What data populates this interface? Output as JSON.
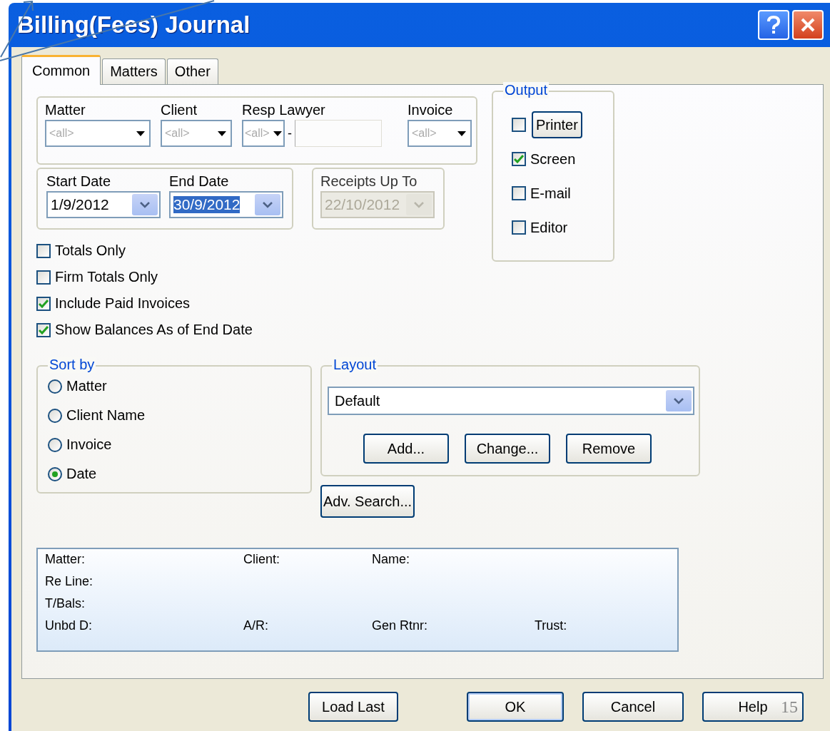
{
  "window": {
    "title": "Billing(Fees) Journal"
  },
  "tabs": [
    {
      "label": "Common",
      "selected": true
    },
    {
      "label": "Matters",
      "selected": false
    },
    {
      "label": "Other",
      "selected": false
    }
  ],
  "filters": [
    {
      "label": "Matter",
      "value": "<all>"
    },
    {
      "label": "Client",
      "value": "<all>"
    },
    {
      "label": "Resp Lawyer",
      "value": "<all>",
      "separator": "-"
    },
    {
      "label": "Invoice",
      "value": "<all>"
    }
  ],
  "dates": [
    {
      "label": "Start Date",
      "value": "1/9/2012",
      "selected": false,
      "disabled": false
    },
    {
      "label": "End Date",
      "value": "30/9/2012",
      "selected": true,
      "disabled": false
    },
    {
      "label": "Receipts Up To",
      "value": "22/10/2012",
      "selected": false,
      "disabled": true
    }
  ],
  "output": {
    "title": "Output",
    "items": [
      {
        "kind": "button",
        "label": "Printer",
        "checked": false
      },
      {
        "kind": "label",
        "label": "Screen",
        "checked": true
      },
      {
        "kind": "label",
        "label": "E-mail",
        "checked": false
      },
      {
        "kind": "label",
        "label": "Editor",
        "checked": false
      }
    ]
  },
  "options": [
    {
      "label": "Totals Only",
      "checked": false
    },
    {
      "label": "Firm Totals Only",
      "checked": false
    },
    {
      "label": "Include Paid Invoices",
      "checked": true
    },
    {
      "label": "Show Balances As of End Date",
      "checked": true
    }
  ],
  "sort_by": {
    "title": "Sort by",
    "options": [
      {
        "label": "Matter",
        "selected": false
      },
      {
        "label": "Client Name",
        "selected": false
      },
      {
        "label": "Invoice",
        "selected": false
      },
      {
        "label": "Date",
        "selected": true
      }
    ]
  },
  "layout": {
    "title": "Layout",
    "value": "Default",
    "buttons": [
      "Add...",
      "Change...",
      "Remove"
    ]
  },
  "adv_search": "Adv. Search...",
  "info": [
    [
      "Matter:",
      "Client:",
      "Name:"
    ],
    [
      "Re Line:"
    ],
    [
      "T/Bals:"
    ],
    [
      "Unbd D:",
      "A/R:",
      "Gen Rtnr:",
      "Trust:"
    ]
  ],
  "footer_buttons": [
    {
      "label": "Load Last",
      "default": false
    },
    {
      "label": "OK",
      "default": true
    },
    {
      "label": "Cancel",
      "default": false
    },
    {
      "label": "Help",
      "default": false
    }
  ],
  "slide_number": "15"
}
